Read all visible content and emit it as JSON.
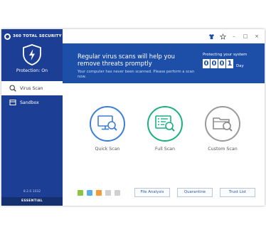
{
  "app": {
    "logo_text": "360 TOTAL SECURITY",
    "protection_status": "Protection: On",
    "version": "8.2.0.1032",
    "edition": "ESSENTIAL"
  },
  "sidebar": {
    "items": [
      {
        "label": "Virus Scan",
        "icon": "virus-scan-icon",
        "active": true
      },
      {
        "label": "Sandbox",
        "icon": "sandbox-icon",
        "active": false
      }
    ]
  },
  "titlebar": {
    "buttons": [
      {
        "name": "shirt-skin-icon",
        "glyph": ""
      },
      {
        "name": "star-icon",
        "glyph": ""
      },
      {
        "name": "minimize-icon",
        "glyph": "–"
      },
      {
        "name": "maximize-icon",
        "glyph": "□"
      },
      {
        "name": "close-icon",
        "glyph": "×"
      }
    ]
  },
  "banner": {
    "headline": "Regular virus scans will help you remove threats promptly",
    "subline": "Your computer has never been scanned. Please perform a scan now.",
    "protecting_label": "Protecting your system",
    "days_digits": [
      "0",
      "0",
      "0",
      "1"
    ],
    "days_unit": "Day"
  },
  "scans": [
    {
      "label": "Quick Scan",
      "color": "#3b7fd9",
      "icon": "monitor-magnifier-icon"
    },
    {
      "label": "Full Scan",
      "color": "#1bb080",
      "icon": "list-magnifier-icon"
    },
    {
      "label": "Custom Scan",
      "color": "#9a9a9a",
      "icon": "folder-magnifier-icon"
    }
  ],
  "bottom": {
    "engines": [
      {
        "name": "engine-1-icon",
        "color": "#8cc63f"
      },
      {
        "name": "engine-2-icon",
        "color": "#5aaee6"
      },
      {
        "name": "engine-3-icon",
        "color": "#f49a3a"
      },
      {
        "name": "engine-4-icon",
        "color": "#bdbdbd"
      },
      {
        "name": "engine-5-icon",
        "color": "#bdbdbd"
      }
    ],
    "buttons": [
      "File Analysis",
      "Quarantine",
      "Trust List"
    ]
  },
  "colors": {
    "sidebar": "#1c3f95",
    "banner": "#1e4fa8",
    "accent_blue": "#3b7fd9",
    "accent_green": "#1bb080"
  }
}
